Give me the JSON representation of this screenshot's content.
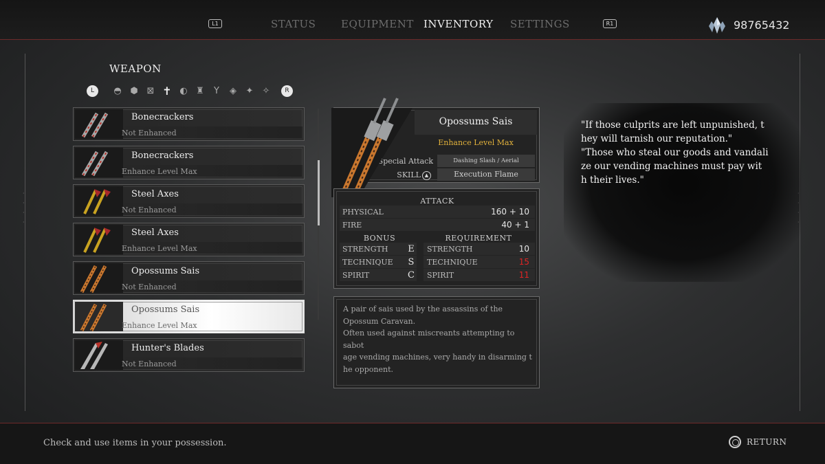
{
  "header": {
    "left_shoulder": "L1",
    "right_shoulder": "R1",
    "tabs": [
      {
        "label": "STATUS",
        "active": false
      },
      {
        "label": "EQUIPMENT",
        "active": false
      },
      {
        "label": "INVENTORY",
        "active": true
      },
      {
        "label": "SETTINGS",
        "active": false
      }
    ],
    "currency": "98765432",
    "currency_icon": "crystal-icon"
  },
  "category": {
    "title": "WEAPON",
    "left_button": "L",
    "right_button": "R",
    "icons": [
      "helmet-icon",
      "shield-icon",
      "crossed-icon",
      "cross-icon",
      "sword-icon",
      "armor-icon",
      "claw-icon",
      "blade-icon",
      "star-icon",
      "shuriken-icon"
    ]
  },
  "items": [
    {
      "name": "Bonecrackers",
      "status": "Not Enhanced"
    },
    {
      "name": "Bonecrackers",
      "status": "Enhance Level Max"
    },
    {
      "name": "Steel Axes",
      "status": "Not Enhanced"
    },
    {
      "name": "Steel Axes",
      "status": "Enhance Level Max"
    },
    {
      "name": "Opossums Sais",
      "status": "Not Enhanced"
    },
    {
      "name": "Opossums Sais",
      "status": "Enhance Level Max"
    },
    {
      "name": "Hunter's Blades",
      "status": "Not Enhanced"
    }
  ],
  "detail": {
    "name": "Opossums Sais",
    "level": "Enhance Level Max",
    "special_attack_label": "Special Attack",
    "special_attack_value": "Dashing Slash / Aerial Whirlwind",
    "skill_label": "SKILL",
    "skill_value": "Execution Flame",
    "level_color": "#e2b23c"
  },
  "stats": {
    "attack_title": "ATTACK",
    "physical_label": "PHYSICAL",
    "physical_value": "160 + 10",
    "fire_label": "FIRE",
    "fire_value": "40 + 1",
    "bonus_title": "BONUS",
    "requirement_title": "REQUIREMENT",
    "bonus": [
      {
        "label": "STRENGTH",
        "grade": "E"
      },
      {
        "label": "TECHNIQUE",
        "grade": "S"
      },
      {
        "label": "SPIRIT",
        "grade": "C"
      }
    ],
    "requirement": [
      {
        "label": "STRENGTH",
        "value": "10"
      },
      {
        "label": "TECHNIQUE",
        "value": "15"
      },
      {
        "label": "SPIRIT",
        "value": "11"
      }
    ],
    "unmet_color": "#e02424"
  },
  "description": "A pair of sais used by the assassins of the\nOpossum Caravan.\nOften used against miscreants attempting to sabot\nage vending machines, very handy in disarming t\nhe opponent.",
  "lore": "\"If those culprits are left unpunished, t\nhey will tarnish our reputation.\"\n\"Those who steal our goods and vandali\nze our vending machines must pay wit\nh their lives.\"",
  "footer": {
    "hint": "Check and use items in your possession.",
    "return_label": "RETURN"
  }
}
